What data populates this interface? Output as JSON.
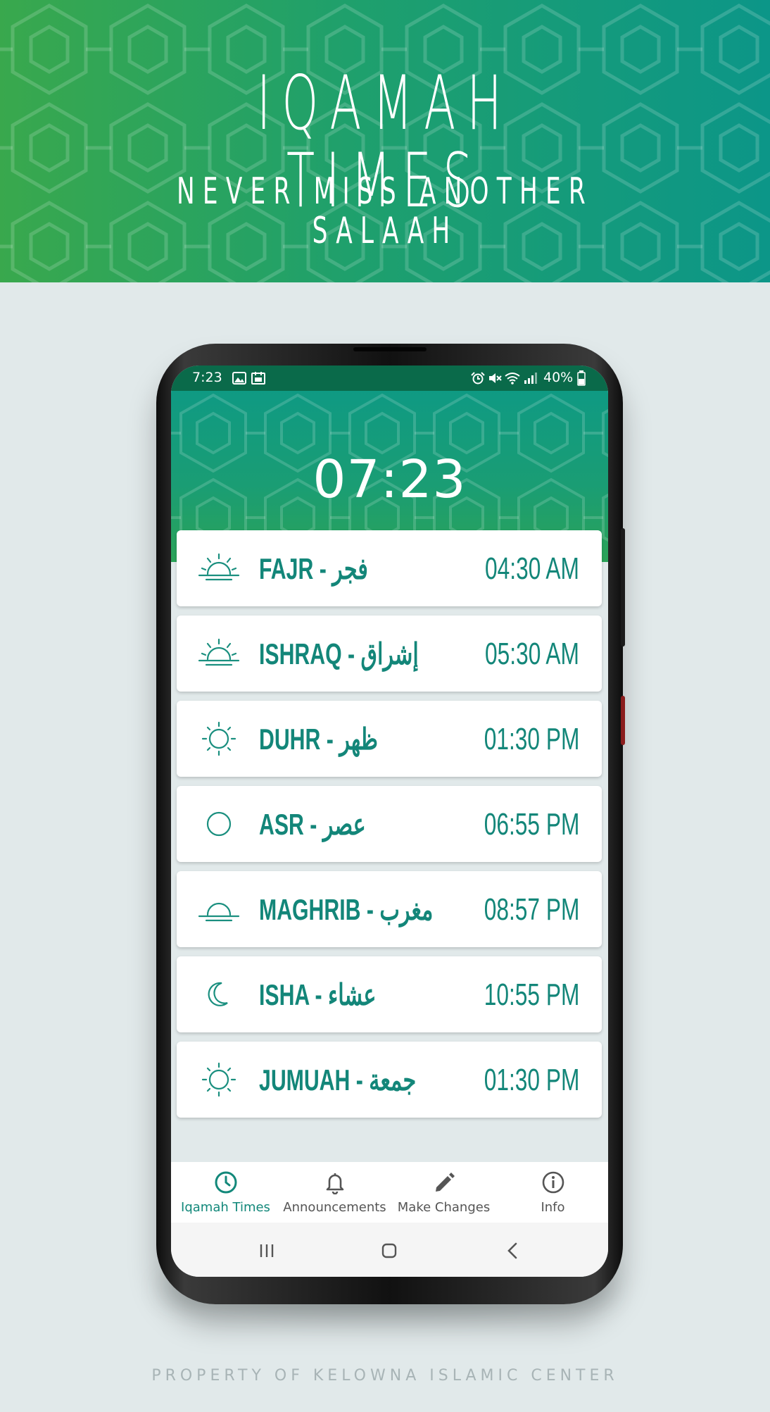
{
  "banner": {
    "title": "IQAMAH TIMES",
    "subtitle": "NEVER MISS ANOTHER SALAAH"
  },
  "status_bar": {
    "time": "7:23",
    "battery": "40%",
    "left_icons": [
      "image-icon",
      "calendar-icon"
    ],
    "right_icons": [
      "alarm-icon",
      "mute-icon",
      "wifi-icon",
      "signal-icon"
    ]
  },
  "header": {
    "clock": "07:23"
  },
  "prayers": [
    {
      "name": "FAJR - فجر",
      "time": "04:30 AM",
      "icon": "sunrise-icon"
    },
    {
      "name": "ISHRAQ - إشراق",
      "time": "05:30 AM",
      "icon": "sunrise-icon"
    },
    {
      "name": "DUHR - ظهر",
      "time": "01:30 PM",
      "icon": "sun-icon"
    },
    {
      "name": "ASR - عصر",
      "time": "06:55 PM",
      "icon": "circle-icon"
    },
    {
      "name": "MAGHRIB - مغرب",
      "time": "08:57 PM",
      "icon": "sunset-icon"
    },
    {
      "name": "ISHA - عشاء",
      "time": "10:55 PM",
      "icon": "moon-icon"
    },
    {
      "name": "JUMUAH - جمعة",
      "time": "01:30 PM",
      "icon": "sun-icon"
    }
  ],
  "nav": [
    {
      "label": "Iqamah Times",
      "icon": "clock-icon",
      "active": true
    },
    {
      "label": "Announcements",
      "icon": "bell-icon",
      "active": false
    },
    {
      "label": "Make Changes",
      "icon": "pencil-icon",
      "active": false
    },
    {
      "label": "Info",
      "icon": "info-icon",
      "active": false
    }
  ],
  "system_nav": [
    "recents-icon",
    "home-icon",
    "back-icon"
  ],
  "footer": "PROPERTY OF KELOWNA ISLAMIC CENTER",
  "colors": {
    "accent": "#138679",
    "banner_start": "#39a84d",
    "banner_end": "#0c9688",
    "status_bar": "#0a6a4a",
    "background": "#e1e9ea"
  }
}
